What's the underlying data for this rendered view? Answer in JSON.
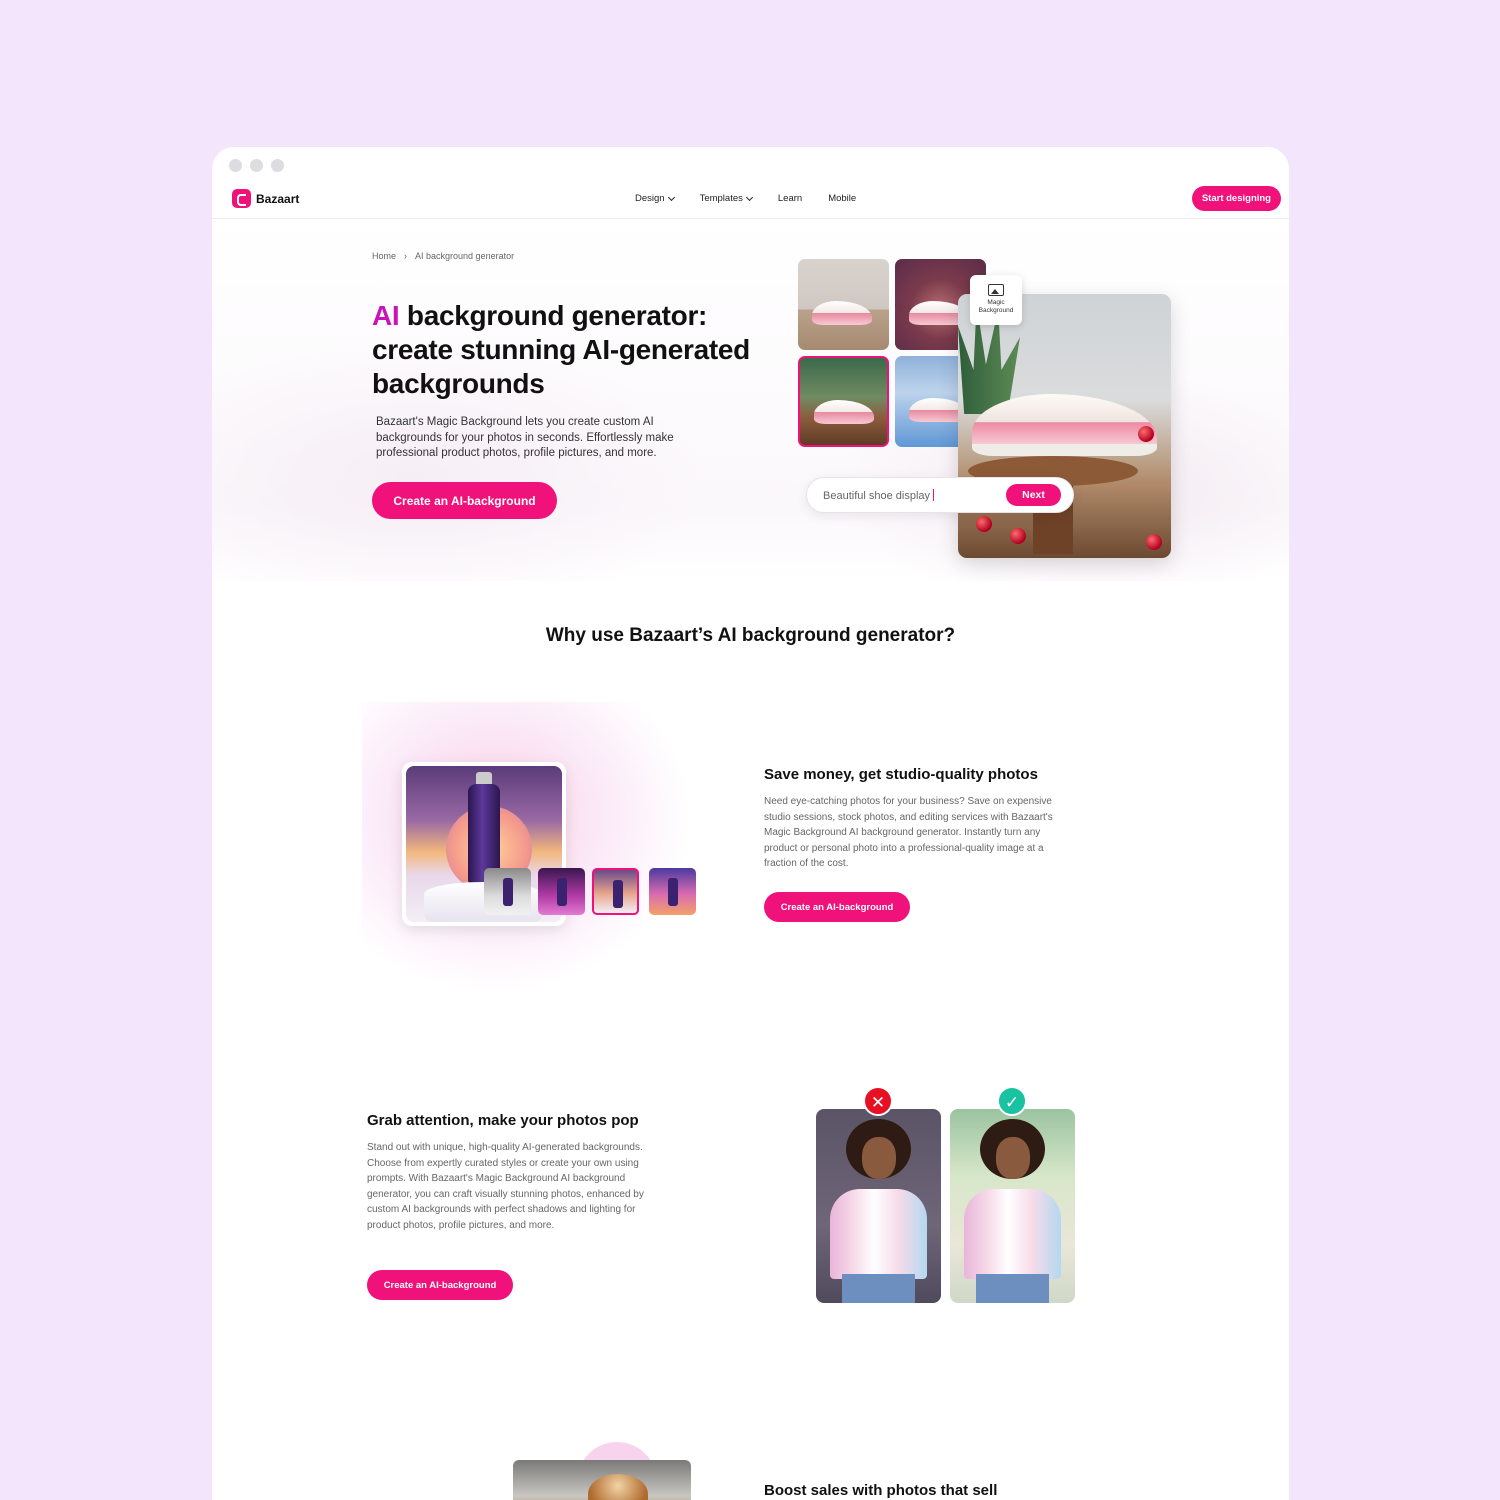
{
  "brand": {
    "name": "Bazaart",
    "accent": "#f0117a",
    "ai_color": "#c814b8"
  },
  "nav": {
    "items": [
      {
        "label": "Design",
        "has_dropdown": true
      },
      {
        "label": "Templates",
        "has_dropdown": true
      },
      {
        "label": "Learn",
        "has_dropdown": false
      },
      {
        "label": "Mobile",
        "has_dropdown": false
      }
    ],
    "cta": "Start designing"
  },
  "hero": {
    "breadcrumb": {
      "home": "Home",
      "separator": "›",
      "current": "AI background generator"
    },
    "title_highlight": "AI",
    "title_rest": " background generator: create stunning AI-generated backgrounds",
    "description": "Bazaart's Magic Background lets you create custom AI backgrounds for your photos in seconds. Effortlessly make professional product photos, profile pictures, and more.",
    "cta": "Create an AI-background",
    "badge": "Magic Background",
    "prompt": {
      "value": "Beautiful shoe display",
      "button": "Next"
    }
  },
  "why_title": "Why use Bazaart’s AI background generator?",
  "sections": [
    {
      "title": "Save money, get studio-quality photos",
      "description": "Need eye-catching photos for your business? Save on expensive studio sessions, stock photos, and editing services with Bazaart's Magic Background AI background generator. Instantly turn any product or personal photo into a professional-quality image at a fraction of the cost.",
      "cta": "Create an AI-background"
    },
    {
      "title": "Grab attention, make your photos pop",
      "description": "Stand out with unique, high-quality AI-generated backgrounds. Choose from expertly curated styles or create your own using prompts. With Bazaart's Magic Background AI background generator, you can craft visually stunning photos, enhanced by custom AI backgrounds with perfect shadows and lighting for product photos, profile pictures, and more.",
      "cta": "Create an AI-background",
      "compare": {
        "bad_icon": "x-icon",
        "good_icon": "check-icon"
      }
    },
    {
      "title": "Boost sales with photos that sell"
    }
  ],
  "colors": {
    "page_bg": "#f3e5fb",
    "bad": "#e81123",
    "good": "#19c2a0"
  }
}
